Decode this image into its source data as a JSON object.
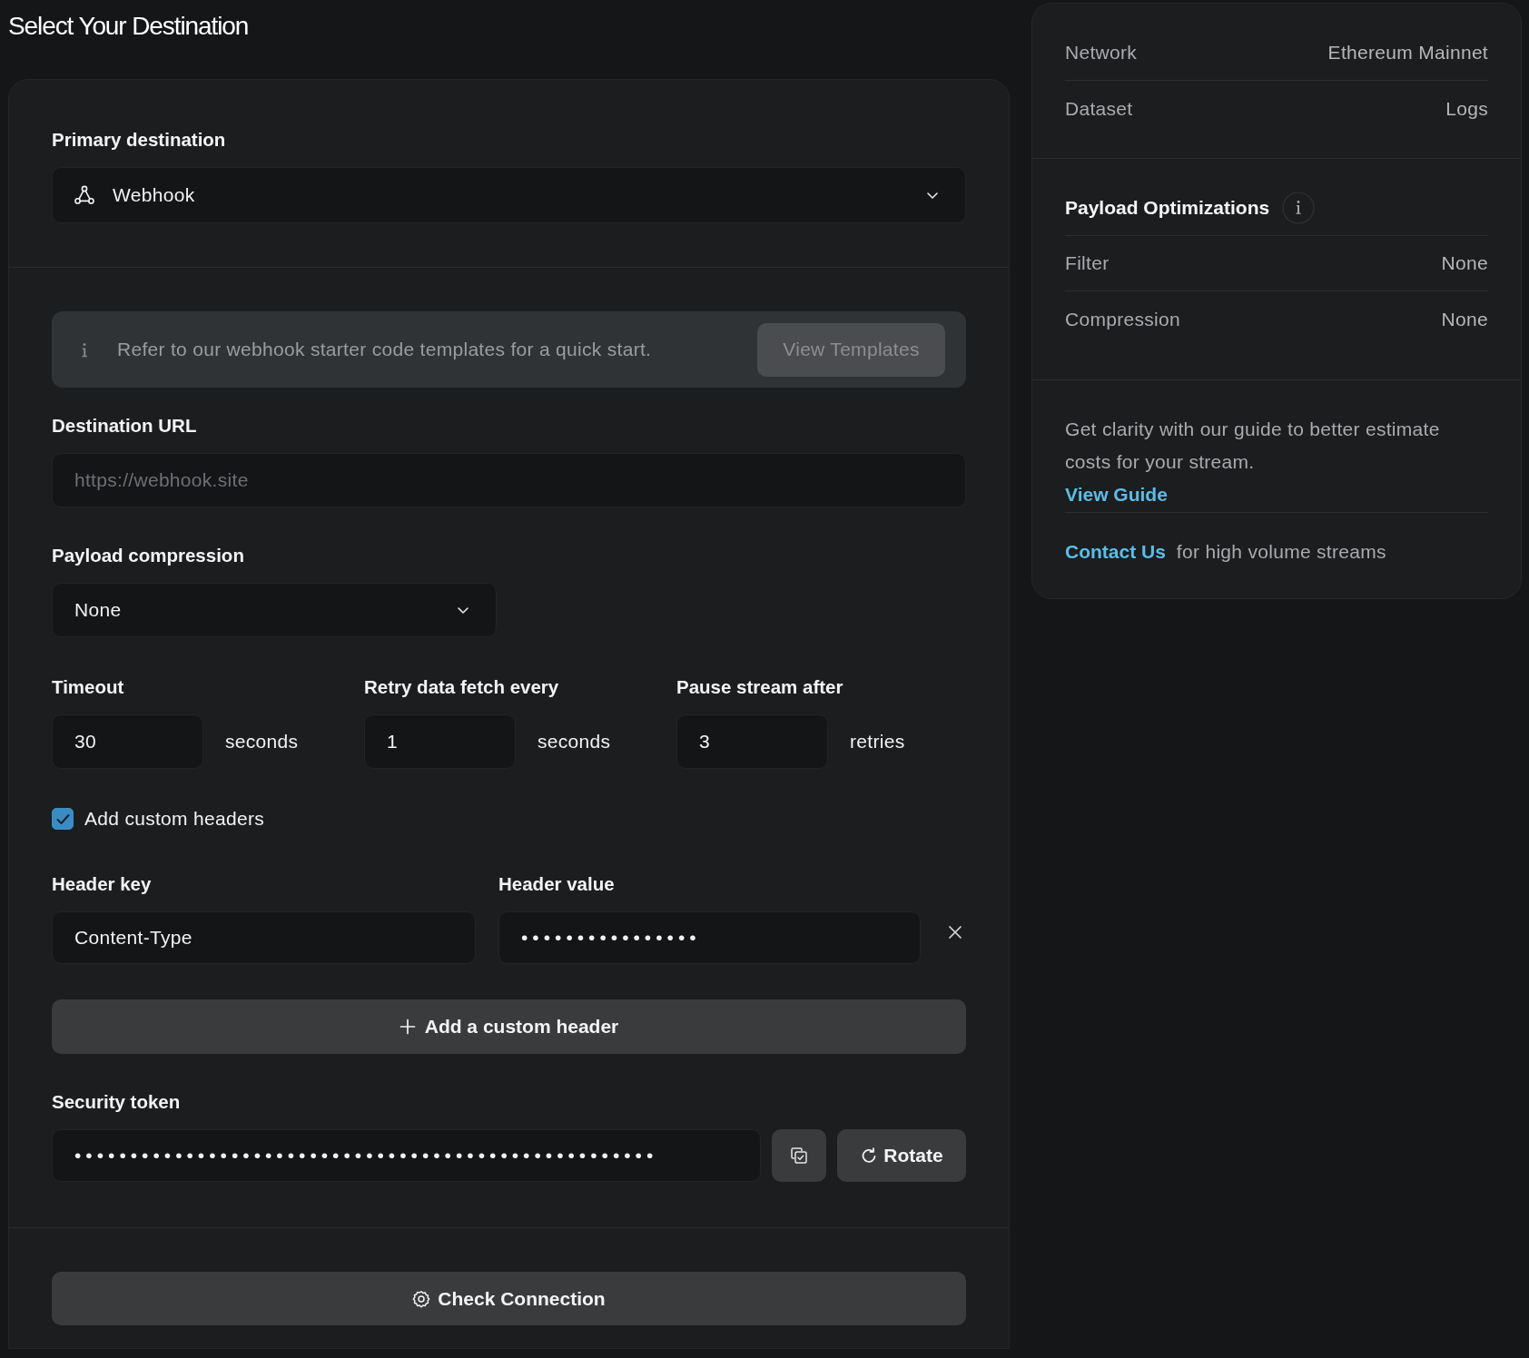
{
  "page": {
    "title": "Select Your Destination"
  },
  "form": {
    "primary_destination": {
      "label": "Primary destination",
      "value": "Webhook"
    },
    "info_banner": {
      "text": "Refer to our webhook starter code templates for a quick start.",
      "button": {
        "label": "View Templates",
        "disabled": true
      }
    },
    "destination_url": {
      "label": "Destination URL",
      "placeholder": "https://webhook.site"
    },
    "payload_compression": {
      "label": "Payload compression",
      "value": "None"
    },
    "timing": [
      {
        "label": "Timeout",
        "value": "30",
        "unit": "seconds"
      },
      {
        "label": "Retry data fetch every",
        "value": "1",
        "unit": "seconds"
      },
      {
        "label": "Pause stream after",
        "value": "3",
        "unit": "retries"
      }
    ],
    "custom_headers": {
      "label": "Add custom headers",
      "checked": true
    },
    "headers": {
      "key_label": "Header key",
      "value_label": "Header value",
      "rows": [
        {
          "key": "Content-Type",
          "value": "••••••••••••••••"
        }
      ]
    },
    "add_header_button": {
      "label": "Add a custom header"
    },
    "security_token": {
      "label": "Security token",
      "value": "••••••••••••••••••••••••••••••••••••••••••••••••••••",
      "rotate_button": {
        "label": "Rotate"
      }
    },
    "check_connection_button": {
      "label": "Check Connection"
    }
  },
  "summary": {
    "details": [
      {
        "label": "Network",
        "value": "Ethereum Mainnet"
      },
      {
        "label": "Dataset",
        "value": "Logs"
      }
    ],
    "optimizations": {
      "title": "Payload Optimizations",
      "rows": [
        {
          "label": "Filter",
          "value": "None"
        },
        {
          "label": "Compression",
          "value": "None"
        }
      ]
    },
    "guide": {
      "text": "Get clarity with our guide to better estimate costs for your stream.",
      "link": "View Guide"
    },
    "contact": {
      "link": "Contact Us",
      "text": "for high volume streams"
    }
  }
}
